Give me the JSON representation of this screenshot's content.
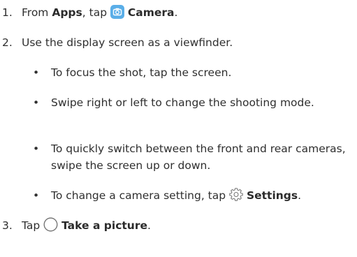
{
  "steps": [
    {
      "number": "1.",
      "prefix": "From ",
      "bold1": "Apps",
      "middle": ", tap ",
      "icon": "camera-app-icon",
      "bold2": "Camera",
      "suffix": "."
    },
    {
      "number": "2.",
      "text": "Use the display screen as a viewfinder."
    },
    {
      "number": "3.",
      "prefix": "Tap ",
      "icon": "shutter-button-icon",
      "bold": "Take a picture",
      "suffix": "."
    }
  ],
  "bullets": [
    {
      "text": "To focus the shot, tap the screen."
    },
    {
      "text": "Swipe right or left to change the shooting mode."
    },
    {
      "text": "To quickly switch between the front and rear cameras, swipe the screen up or down."
    },
    {
      "prefix": "To change a camera setting, tap ",
      "icon": "settings-gear-icon",
      "bold": "Settings",
      "suffix": "."
    }
  ],
  "colors": {
    "text": "#2f2f2f",
    "camera_icon_bg": "#5aaee8"
  }
}
